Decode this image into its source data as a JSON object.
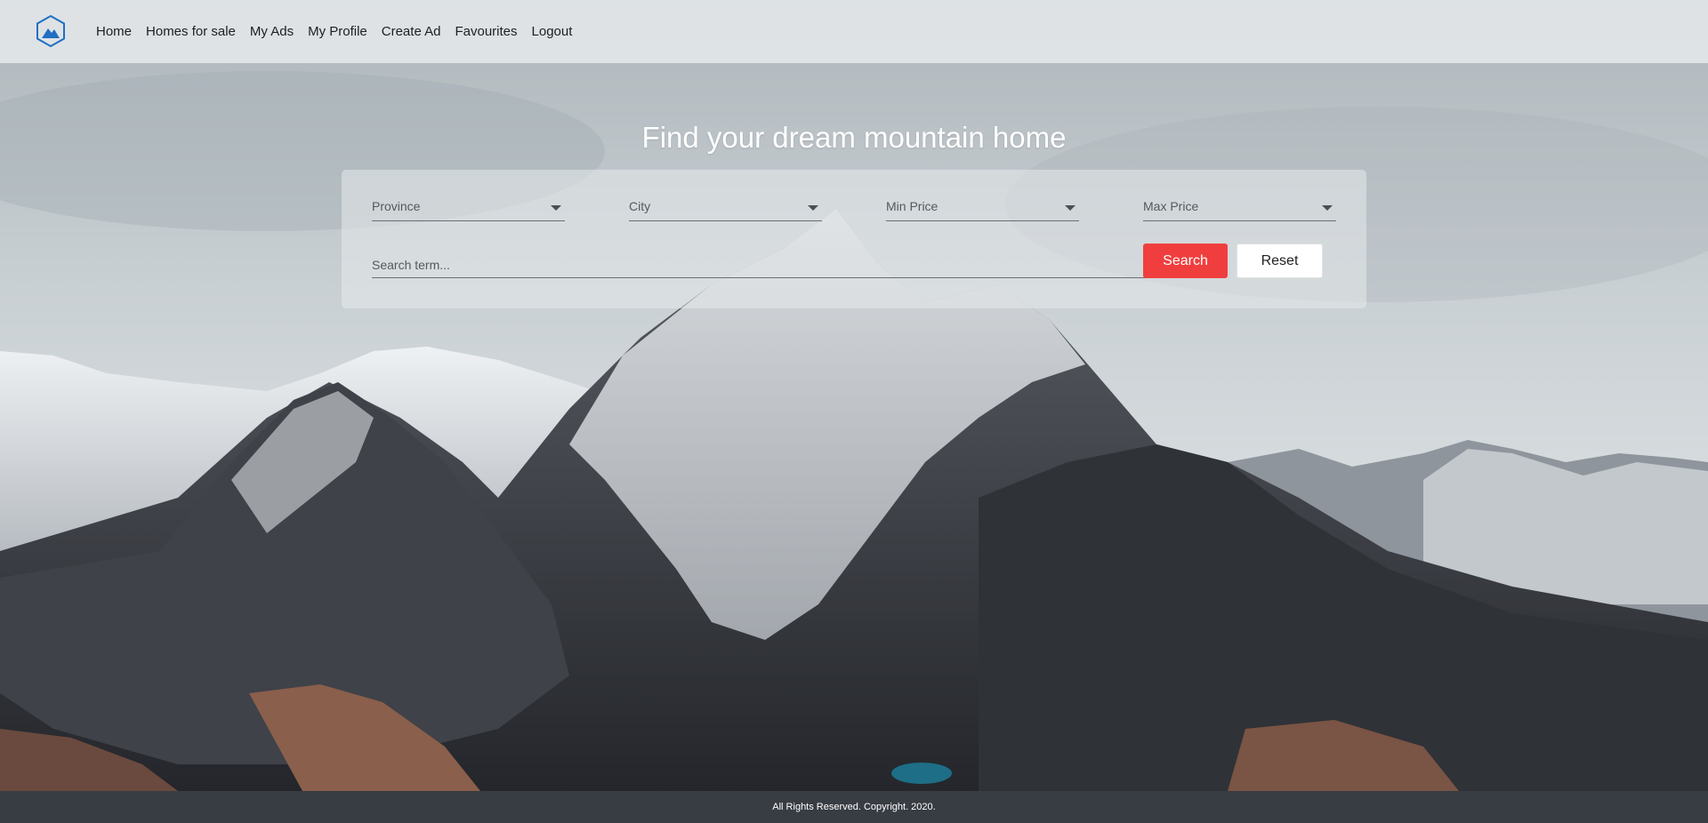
{
  "nav": {
    "logo_icon": "mountain-hexagon-logo",
    "links": [
      "Home",
      "Homes for sale",
      "My Ads",
      "My Profile",
      "Create Ad",
      "Favourites",
      "Logout"
    ]
  },
  "hero": {
    "headline": "Find your dream mountain home",
    "background": "snowy-mountain-range-photo"
  },
  "search": {
    "province_label": "Province",
    "city_label": "City",
    "min_price_label": "Min Price",
    "max_price_label": "Max Price",
    "term_placeholder": "Search term...",
    "search_button": "Search",
    "reset_button": "Reset"
  },
  "footer": {
    "text": "All Rights Reserved. Copyright. 2020."
  },
  "colors": {
    "accent": "#f03e3e",
    "footer_bg": "#383c43",
    "logo_blue": "#1f6fc2"
  }
}
